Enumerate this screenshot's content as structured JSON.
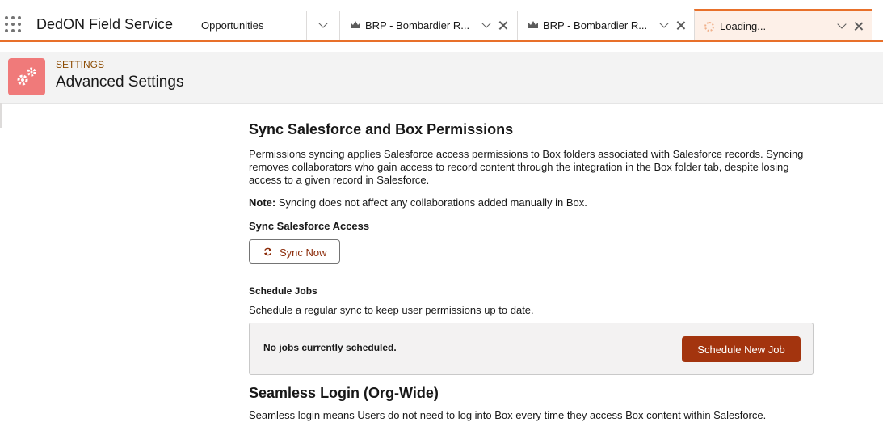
{
  "app": {
    "name": "DedON Field Service"
  },
  "nav": {
    "object_tab_label": "Opportunities",
    "tabs": [
      {
        "label": "BRP - Bombardier R..."
      },
      {
        "label": "BRP - Bombardier R..."
      },
      {
        "label": "Loading..."
      }
    ]
  },
  "header": {
    "eyebrow": "SETTINGS",
    "title": "Advanced Settings"
  },
  "sync": {
    "title": "Sync Salesforce and Box Permissions",
    "description": "Permissions syncing applies Salesforce access permissions to Box folders associated with Salesforce records. Syncing removes collaborators who gain access to record content through the integration in the Box folder tab, despite losing access to a given record in Salesforce.",
    "note_label": "Note:",
    "note_text": " Syncing does not affect any collaborations added manually in Box.",
    "access_heading": "Sync Salesforce Access",
    "sync_button": "Sync Now"
  },
  "schedule": {
    "heading": "Schedule Jobs",
    "description": "Schedule a regular sync to keep user permissions up to date.",
    "empty_message": "No jobs currently scheduled.",
    "new_job_button": "Schedule New Job"
  },
  "seamless": {
    "title": "Seamless Login (Org-Wide)",
    "description": "Seamless login means Users do not need to log into Box every time they access Box content within Salesforce."
  },
  "colors": {
    "accent": "#e8702a",
    "brand_button": "#a3340e",
    "header_icon": "#f07a7a"
  }
}
